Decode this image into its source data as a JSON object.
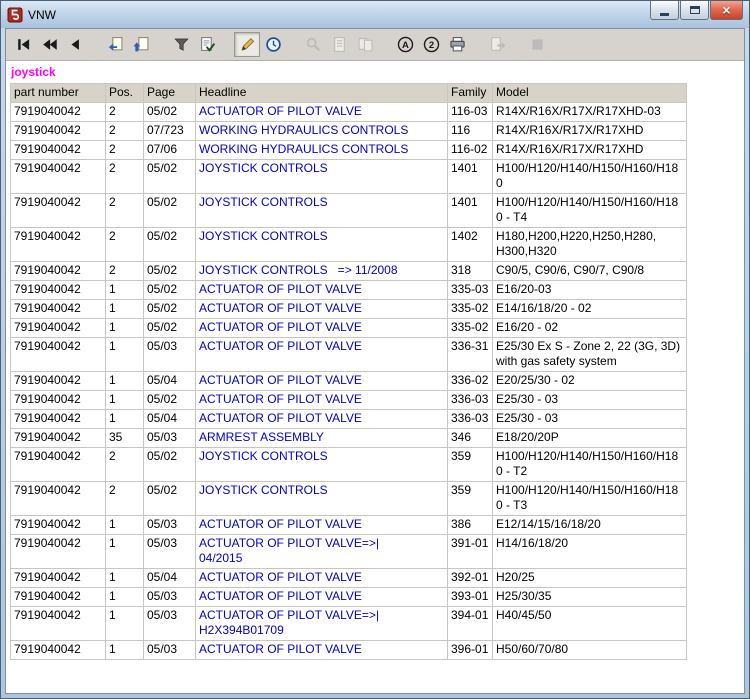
{
  "window": {
    "title": "VNW"
  },
  "titlebar": {
    "close_glyph": "×"
  },
  "search_term": "joystick",
  "toolbar": {
    "buttons": [
      {
        "name": "goto-first",
        "icon": "goto-first-icon",
        "enabled": true
      },
      {
        "name": "previous-fast",
        "icon": "previous-fast-icon",
        "enabled": true
      },
      {
        "name": "previous",
        "icon": "previous-icon",
        "enabled": true
      },
      {
        "name": "separator"
      },
      {
        "name": "goto-figure",
        "icon": "page-arrow-left-icon",
        "enabled": true
      },
      {
        "name": "goto-parent-list",
        "icon": "page-arrow-up-icon",
        "enabled": true
      },
      {
        "name": "separator"
      },
      {
        "name": "filter",
        "icon": "funnel-icon",
        "enabled": true
      },
      {
        "name": "checklist",
        "icon": "document-check-icon",
        "enabled": true
      },
      {
        "name": "separator"
      },
      {
        "name": "annotate",
        "icon": "pen-icon",
        "enabled": true,
        "pressed": true
      },
      {
        "name": "history",
        "icon": "clock-icon",
        "enabled": true
      },
      {
        "name": "separator"
      },
      {
        "name": "zoom",
        "icon": "magnifier-icon",
        "enabled": false
      },
      {
        "name": "page-view",
        "icon": "page-icon",
        "enabled": false
      },
      {
        "name": "two-page-view",
        "icon": "two-pages-icon",
        "enabled": false
      },
      {
        "name": "separator"
      },
      {
        "name": "circle-a",
        "icon": "circle-a-icon",
        "enabled": true
      },
      {
        "name": "circle-2",
        "icon": "circle-2-icon",
        "enabled": true
      },
      {
        "name": "print",
        "icon": "printer-icon",
        "enabled": true
      },
      {
        "name": "separator"
      },
      {
        "name": "export",
        "icon": "page-arrow-right-icon",
        "enabled": false
      },
      {
        "name": "separator"
      },
      {
        "name": "stop",
        "icon": "stop-icon",
        "enabled": false
      }
    ]
  },
  "table": {
    "headers": [
      "part number",
      "Pos.",
      "Page",
      "Headline",
      "Family",
      "Model"
    ],
    "rows": [
      {
        "part_number": "7919040042",
        "pos": "2",
        "page": "05/02",
        "headline": "ACTUATOR OF PILOT VALVE",
        "family": "116-03",
        "model": "R14X/R16X/R17X/R17XHD-03"
      },
      {
        "part_number": "7919040042",
        "pos": "2",
        "page": "07/723",
        "headline": "WORKING HYDRAULICS CONTROLS",
        "family": "116",
        "model": "R14X/R16X/R17X/R17XHD"
      },
      {
        "part_number": "7919040042",
        "pos": "2",
        "page": "07/06",
        "headline": "WORKING HYDRAULICS CONTROLS",
        "family": "116-02",
        "model": "R14X/R16X/R17X/R17XHD"
      },
      {
        "part_number": "7919040042",
        "pos": "2",
        "page": "05/02",
        "headline": "JOYSTICK CONTROLS",
        "family": "1401",
        "model": "H100/H120/H140/H150/H160/H180"
      },
      {
        "part_number": "7919040042",
        "pos": "2",
        "page": "05/02",
        "headline": "JOYSTICK CONTROLS",
        "family": "1401",
        "model": "H100/H120/H140/H150/H160/H180 - T4"
      },
      {
        "part_number": "7919040042",
        "pos": "2",
        "page": "05/02",
        "headline": "JOYSTICK CONTROLS",
        "family": "1402",
        "model": "H180,H200,H220,H250,H280, H300,H320"
      },
      {
        "part_number": "7919040042",
        "pos": "2",
        "page": "05/02",
        "headline": "JOYSTICK CONTROLS   => 11/2008",
        "family": "318",
        "model": "C90/5, C90/6, C90/7, C90/8"
      },
      {
        "part_number": "7919040042",
        "pos": "1",
        "page": "05/02",
        "headline": "ACTUATOR OF PILOT VALVE",
        "family": "335-03",
        "model": "E16/20-03"
      },
      {
        "part_number": "7919040042",
        "pos": "1",
        "page": "05/02",
        "headline": "ACTUATOR OF PILOT VALVE",
        "family": "335-02",
        "model": "E14/16/18/20 - 02"
      },
      {
        "part_number": "7919040042",
        "pos": "1",
        "page": "05/02",
        "headline": "ACTUATOR OF PILOT VALVE",
        "family": "335-02",
        "model": "E16/20 - 02"
      },
      {
        "part_number": "7919040042",
        "pos": "1",
        "page": "05/03",
        "headline": "ACTUATOR OF PILOT VALVE",
        "family": "336-31",
        "model": "E25/30 Ex S - Zone 2, 22 (3G, 3D) with gas safety system"
      },
      {
        "part_number": "7919040042",
        "pos": "1",
        "page": "05/04",
        "headline": "ACTUATOR OF PILOT VALVE",
        "family": "336-02",
        "model": "E20/25/30 - 02"
      },
      {
        "part_number": "7919040042",
        "pos": "1",
        "page": "05/02",
        "headline": "ACTUATOR OF PILOT VALVE",
        "family": "336-03",
        "model": "E25/30 - 03"
      },
      {
        "part_number": "7919040042",
        "pos": "1",
        "page": "05/04",
        "headline": "ACTUATOR OF PILOT VALVE",
        "family": "336-03",
        "model": "E25/30 - 03"
      },
      {
        "part_number": "7919040042",
        "pos": "35",
        "page": "05/03",
        "headline": "ARMREST ASSEMBLY",
        "family": "346",
        "model": "E18/20/20P"
      },
      {
        "part_number": "7919040042",
        "pos": "2",
        "page": "05/02",
        "headline": "JOYSTICK CONTROLS",
        "family": "359",
        "model": "H100/H120/H140/H150/H160/H180 - T2"
      },
      {
        "part_number": "7919040042",
        "pos": "2",
        "page": "05/02",
        "headline": "JOYSTICK CONTROLS",
        "family": "359",
        "model": "H100/H120/H140/H150/H160/H180 - T3"
      },
      {
        "part_number": "7919040042",
        "pos": "1",
        "page": "05/03",
        "headline": "ACTUATOR OF PILOT VALVE",
        "family": "386",
        "model": "E12/14/15/16/18/20"
      },
      {
        "part_number": "7919040042",
        "pos": "1",
        "page": "05/03",
        "headline": "ACTUATOR OF PILOT VALVE=>|\n04/2015",
        "family": "391-01",
        "model": "H14/16/18/20"
      },
      {
        "part_number": "7919040042",
        "pos": "1",
        "page": "05/04",
        "headline": "ACTUATOR OF PILOT VALVE",
        "family": "392-01",
        "model": "H20/25"
      },
      {
        "part_number": "7919040042",
        "pos": "1",
        "page": "05/03",
        "headline": "ACTUATOR OF PILOT VALVE",
        "family": "393-01",
        "model": "H25/30/35"
      },
      {
        "part_number": "7919040042",
        "pos": "1",
        "page": "05/03",
        "headline": "ACTUATOR OF PILOT VALVE=>|\nH2X394B01709",
        "family": "394-01",
        "model": "H40/45/50"
      },
      {
        "part_number": "7919040042",
        "pos": "1",
        "page": "05/03",
        "headline": "ACTUATOR OF PILOT VALVE",
        "family": "396-01",
        "model": "H50/60/70/80"
      }
    ]
  }
}
